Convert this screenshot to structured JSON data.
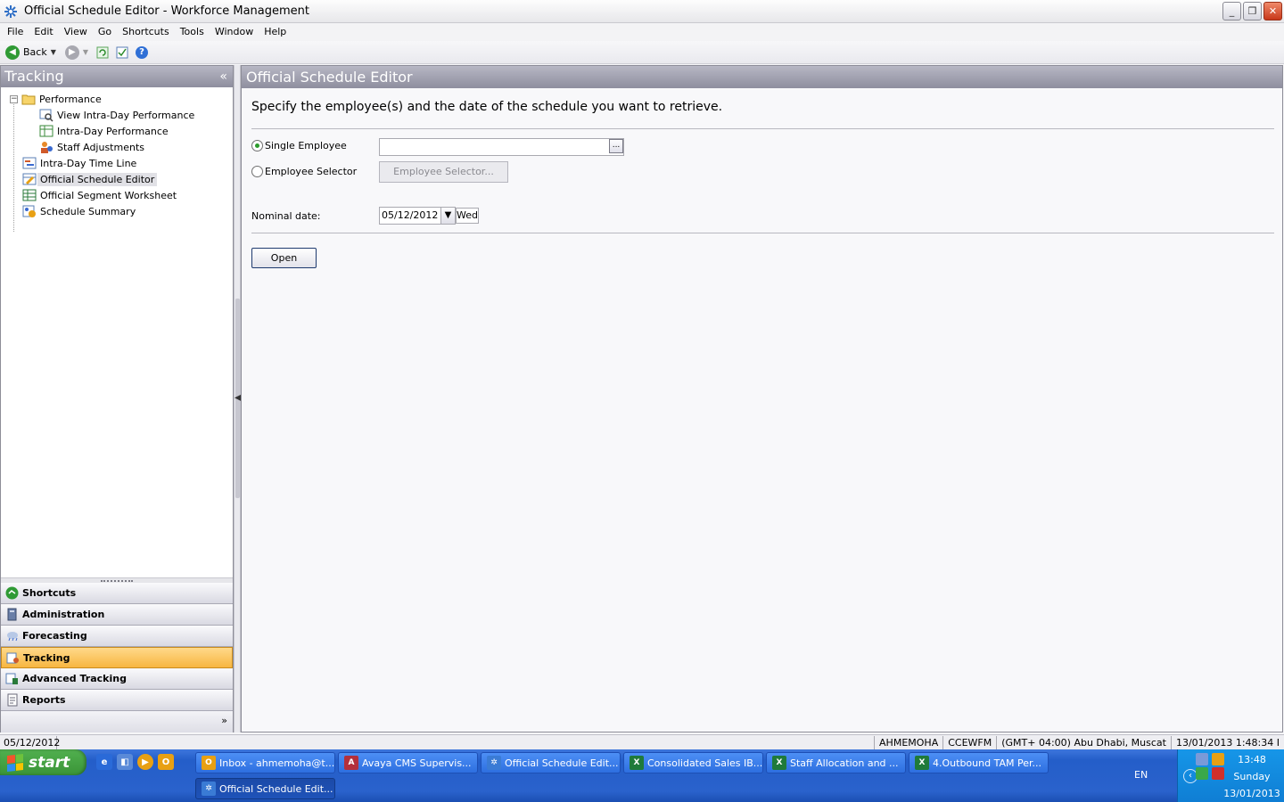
{
  "window": {
    "title": "Official Schedule Editor - Workforce Management",
    "minimize_glyph": "_",
    "restore_glyph": "❐",
    "close_glyph": "✕"
  },
  "menu": [
    "File",
    "Edit",
    "View",
    "Go",
    "Shortcuts",
    "Tools",
    "Window",
    "Help"
  ],
  "toolbar": {
    "back_label": "Back",
    "back_icon": "back-arrow-icon",
    "forward_icon": "forward-arrow-icon",
    "refresh_icon": "refresh-icon",
    "tasks_icon": "checklist-icon",
    "help_icon": "help-icon",
    "help_glyph": "?"
  },
  "left_panel": {
    "title": "Tracking",
    "collapse_glyph": "«",
    "tree": {
      "root": "Performance",
      "root_expander": "−",
      "children": [
        "View Intra-Day Performance",
        "Intra-Day Performance",
        "Staff Adjustments"
      ],
      "items": [
        "Intra-Day Time Line",
        "Official Schedule Editor",
        "Official Segment Worksheet",
        "Schedule Summary"
      ],
      "selected": "Official Schedule Editor"
    },
    "nav_buttons": [
      "Shortcuts",
      "Administration",
      "Forecasting",
      "Tracking",
      "Advanced Tracking",
      "Reports"
    ],
    "active_nav": "Tracking",
    "more_glyph": "»"
  },
  "main_panel": {
    "title": "Official Schedule Editor",
    "instruction": "Specify the employee(s) and the date of the schedule you want to retrieve.",
    "single_employee_label": "Single Employee",
    "single_employee_value": "",
    "browse_glyph": "...",
    "employee_selector_label": "Employee Selector",
    "employee_selector_button": "Employee Selector...",
    "nominal_date_label": "Nominal date:",
    "nominal_date_value": "05/12/2012",
    "date_drop_glyph": "▼",
    "day_of_week": "Wed",
    "open_button": "Open",
    "selected_mode": "single"
  },
  "status_bar": {
    "date": "05/12/2012",
    "user": "AHMEMOHA",
    "server": "CCEWFM",
    "timezone": "(GMT+ 04:00) Abu Dhabi, Muscat",
    "timestamp": "13/01/2013 1:48:34 I"
  },
  "taskbar": {
    "start_label": "start",
    "buttons": [
      {
        "label": "Inbox - ahmemoha@t...",
        "icon": "outlook-icon",
        "color": "#e8a013",
        "glyph": "O"
      },
      {
        "label": "Avaya CMS Supervis...",
        "icon": "avaya-icon",
        "color": "#b3303c",
        "glyph": "A"
      },
      {
        "label": "Official Schedule Edit...",
        "icon": "wfm-icon",
        "color": "#3a7bd5",
        "glyph": "✲"
      },
      {
        "label": "Consolidated Sales IB...",
        "icon": "excel-icon",
        "color": "#1f7a3a",
        "glyph": "X"
      },
      {
        "label": "Staff Allocation and ...",
        "icon": "excel-icon",
        "color": "#1f7a3a",
        "glyph": "X"
      },
      {
        "label": "4.Outbound TAM Per...",
        "icon": "excel-icon",
        "color": "#1f7a3a",
        "glyph": "X"
      }
    ],
    "active_button": "Official Schedule Edit...",
    "language": "EN",
    "tray_arrow_glyph": "‹",
    "clock_time": "13:48",
    "clock_day": "Sunday",
    "clock_date": "13/01/2013"
  },
  "colors": {
    "header_gradient_top": "#b7b7c4",
    "active_nav": "#f7b640",
    "taskbar_blue": "#245ec9",
    "start_green": "#3a9437"
  }
}
